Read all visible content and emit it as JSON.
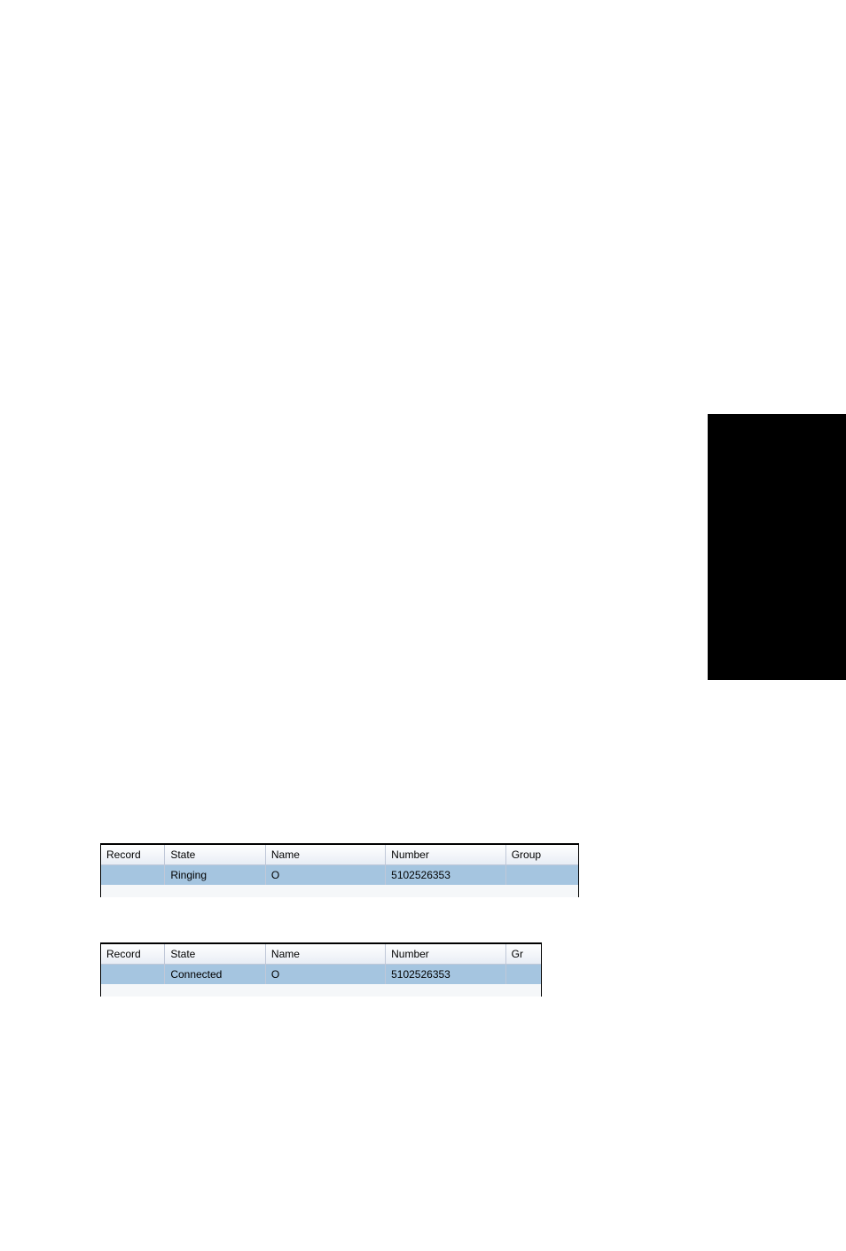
{
  "tables": [
    {
      "headers": [
        "Record",
        "State",
        "Name",
        "Number",
        "Group"
      ],
      "row": {
        "record": "",
        "state": "Ringing",
        "name": "O",
        "number": "5102526353",
        "group": ""
      }
    },
    {
      "headers": [
        "Record",
        "State",
        "Name",
        "Number",
        "Gr"
      ],
      "row": {
        "record": "",
        "state": "Connected",
        "name": "O",
        "number": "5102526353",
        "group": ""
      }
    }
  ]
}
